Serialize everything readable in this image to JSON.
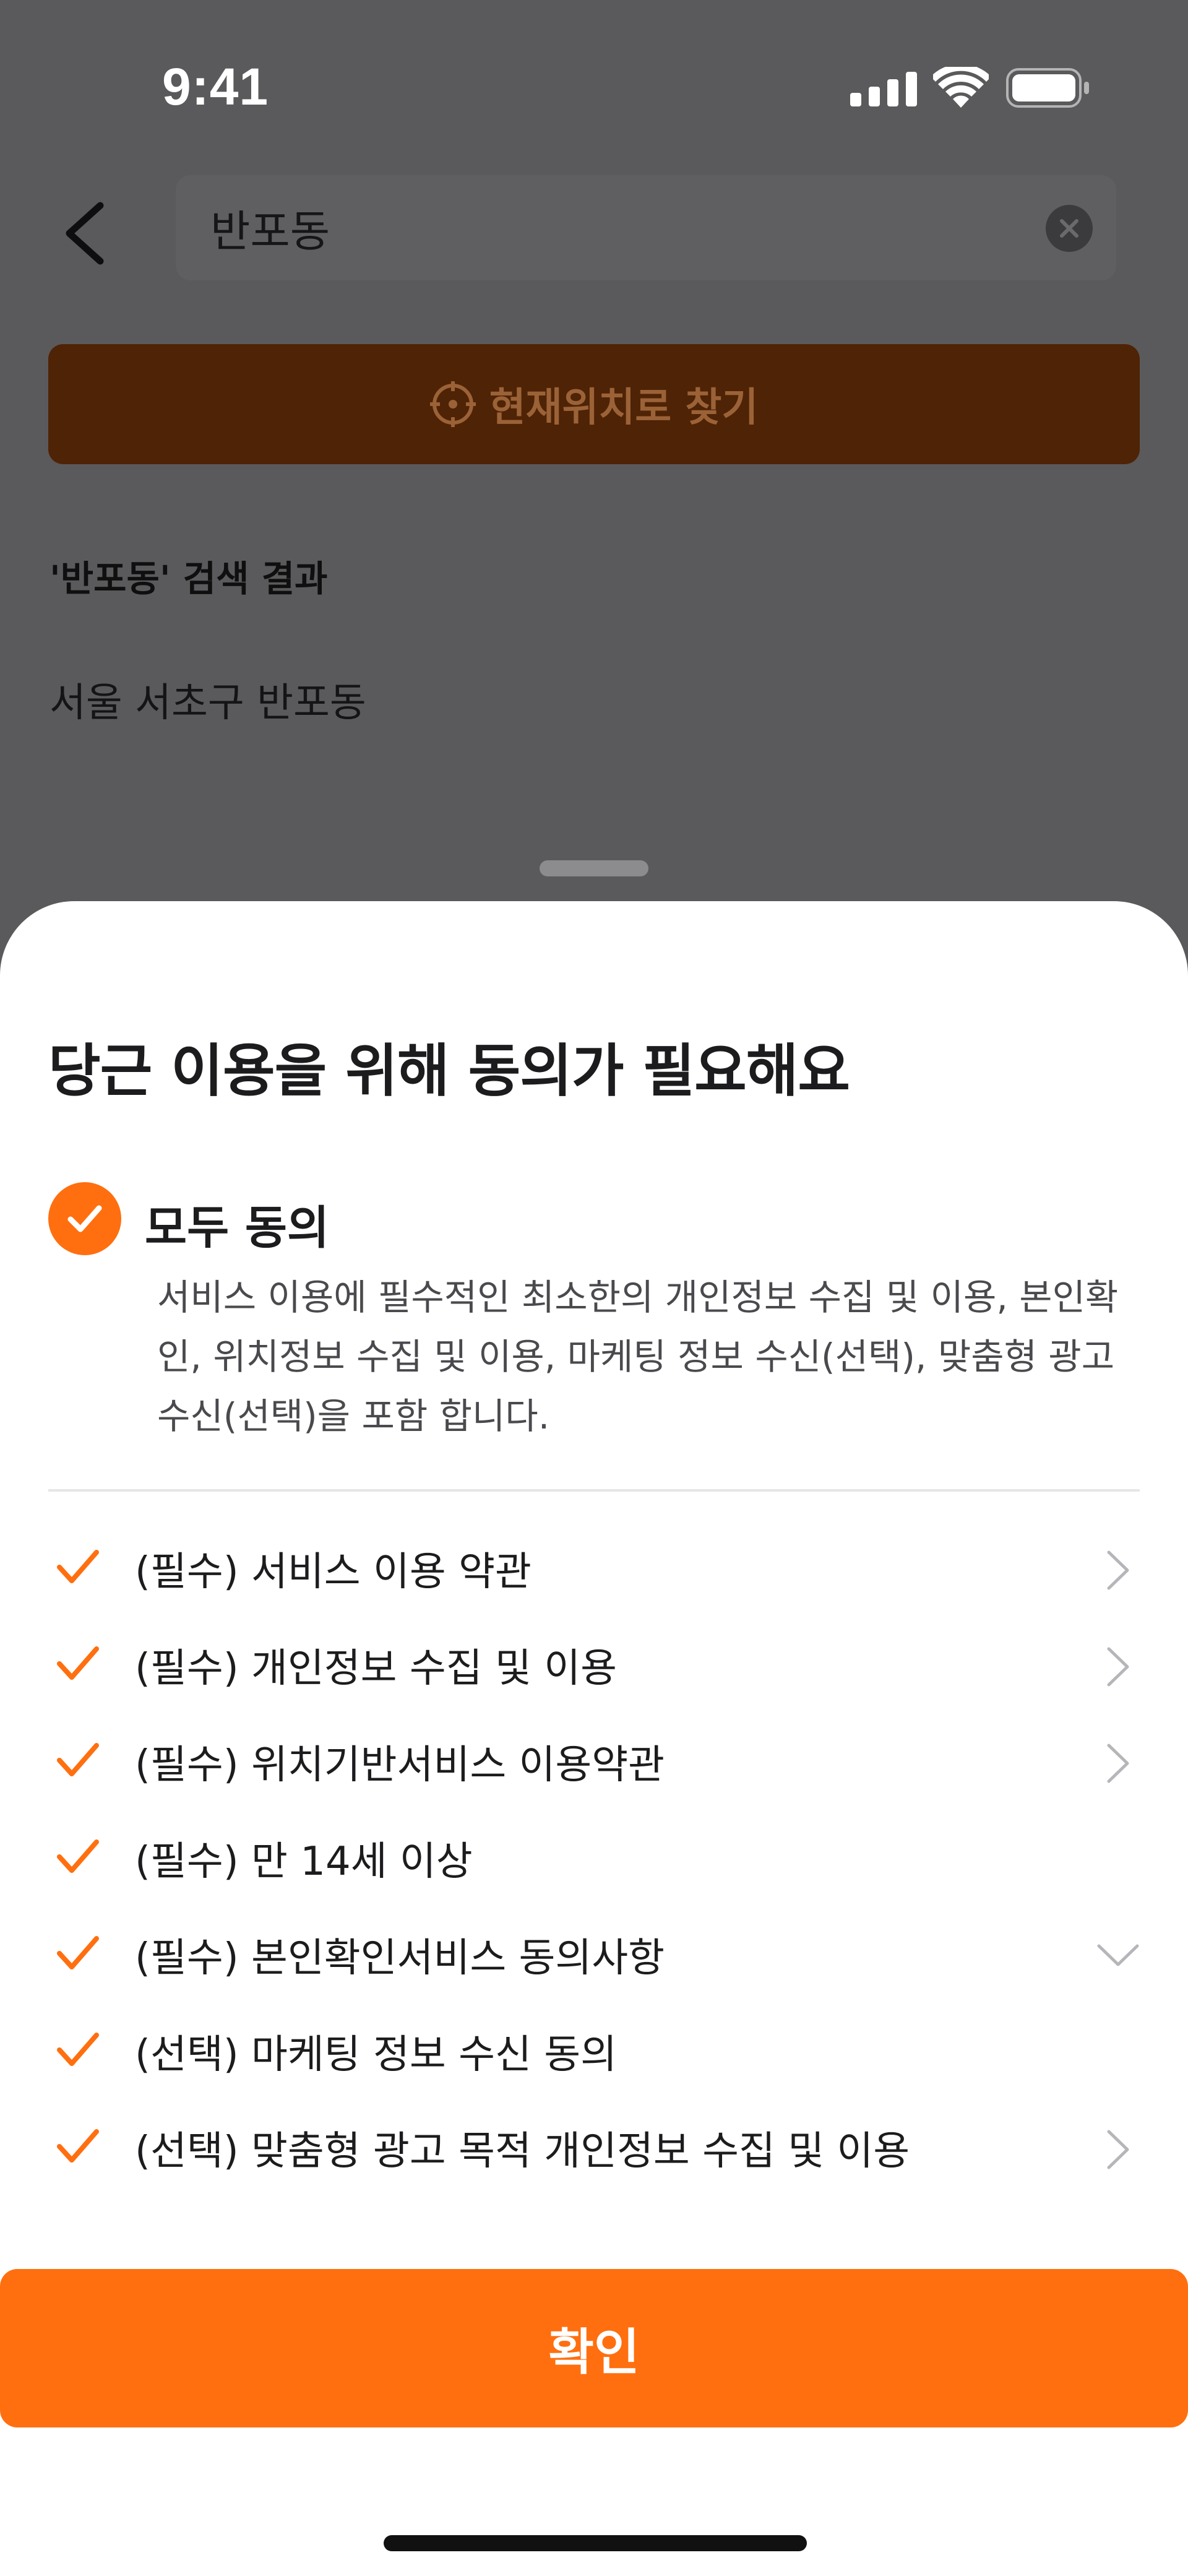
{
  "status_bar": {
    "time": "9:41",
    "icons": [
      "cellular-signal-icon",
      "wifi-icon",
      "battery-icon"
    ]
  },
  "search": {
    "value": "반포동",
    "back_icon": "chevron-left-icon",
    "clear_icon": "clear-icon"
  },
  "location_button": {
    "label": "현재위치로 찾기",
    "icon": "crosshair-icon"
  },
  "results": {
    "title": "'반포동' 검색 결과",
    "items": [
      "서울 서초구 반포동"
    ]
  },
  "consent_sheet": {
    "title": "당근 이용을 위해 동의가 필요해요",
    "agree_all_label": "모두 동의",
    "agree_all_description": "서비스 이용에 필수적인 최소한의 개인정보 수집 및 이용, 본인확인, 위치정보 수집 및 이용, 마케팅 정보 수신(선택), 맞춤형 광고 수신(선택)을 포함 합니다.",
    "terms": [
      {
        "label": "(필수) 서비스 이용 약관",
        "action": "arrow"
      },
      {
        "label": "(필수) 개인정보 수집 및 이용",
        "action": "arrow"
      },
      {
        "label": "(필수) 위치기반서비스 이용약관",
        "action": "arrow"
      },
      {
        "label": "(필수) 만 14세 이상",
        "action": "none"
      },
      {
        "label": "(필수) 본인확인서비스 동의사항",
        "action": "expand"
      },
      {
        "label": "(선택) 마케팅 정보 수신 동의",
        "action": "none"
      },
      {
        "label": "(선택) 맞춤형 광고 목적 개인정보 수집 및 이용",
        "action": "arrow"
      }
    ],
    "confirm_label": "확인"
  },
  "colors": {
    "accent": "#ff6f0f",
    "overlay": "#5a5a5c",
    "sheet_background": "#ffffff",
    "text_primary": "#1c1c1e",
    "text_secondary": "#4a4a4e"
  }
}
